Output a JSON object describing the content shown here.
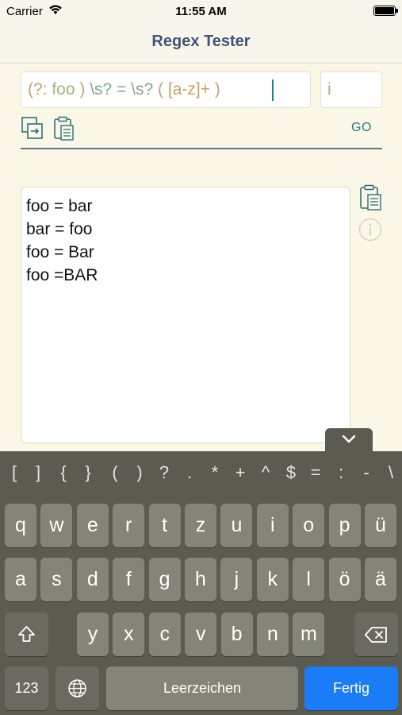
{
  "status_bar": {
    "carrier": "Carrier",
    "time": "11:55 AM"
  },
  "navbar": {
    "title": "Regex Tester"
  },
  "regex": {
    "tokens": [
      {
        "text": "(?: ",
        "color": "#bfa46d"
      },
      {
        "text": "foo",
        "color": "#9ab87a"
      },
      {
        "text": " ) ",
        "color": "#bfa46d"
      },
      {
        "text": "\\s? = \\s?",
        "color": "#7fa88a"
      },
      {
        "text": " ( ",
        "color": "#bfa46d"
      },
      {
        "text": "[a-z]+",
        "color": "#c8a060"
      },
      {
        "text": " )",
        "color": "#bfa46d"
      }
    ],
    "flags": "i",
    "go_label": "GO"
  },
  "test_text": [
    "foo = bar",
    "bar = foo",
    "foo = Bar",
    "foo =BAR"
  ],
  "keyboard": {
    "symbols": [
      "[",
      "]",
      "{",
      "}",
      "(",
      ")",
      "?",
      ".",
      "*",
      "+",
      "^",
      "$",
      "=",
      ":",
      "-",
      "\\"
    ],
    "row1": [
      "q",
      "w",
      "e",
      "r",
      "t",
      "z",
      "u",
      "i",
      "o",
      "p",
      "ü"
    ],
    "row2": [
      "a",
      "s",
      "d",
      "f",
      "g",
      "h",
      "j",
      "k",
      "l",
      "ö",
      "ä"
    ],
    "row3": [
      "y",
      "x",
      "c",
      "v",
      "b",
      "n",
      "m"
    ],
    "numbers_label": "123",
    "space_label": "Leerzeichen",
    "return_label": "Fertig"
  },
  "colors": {
    "accent": "#2a7a88",
    "title": "#3f5478",
    "return_key": "#1a7cf6"
  }
}
